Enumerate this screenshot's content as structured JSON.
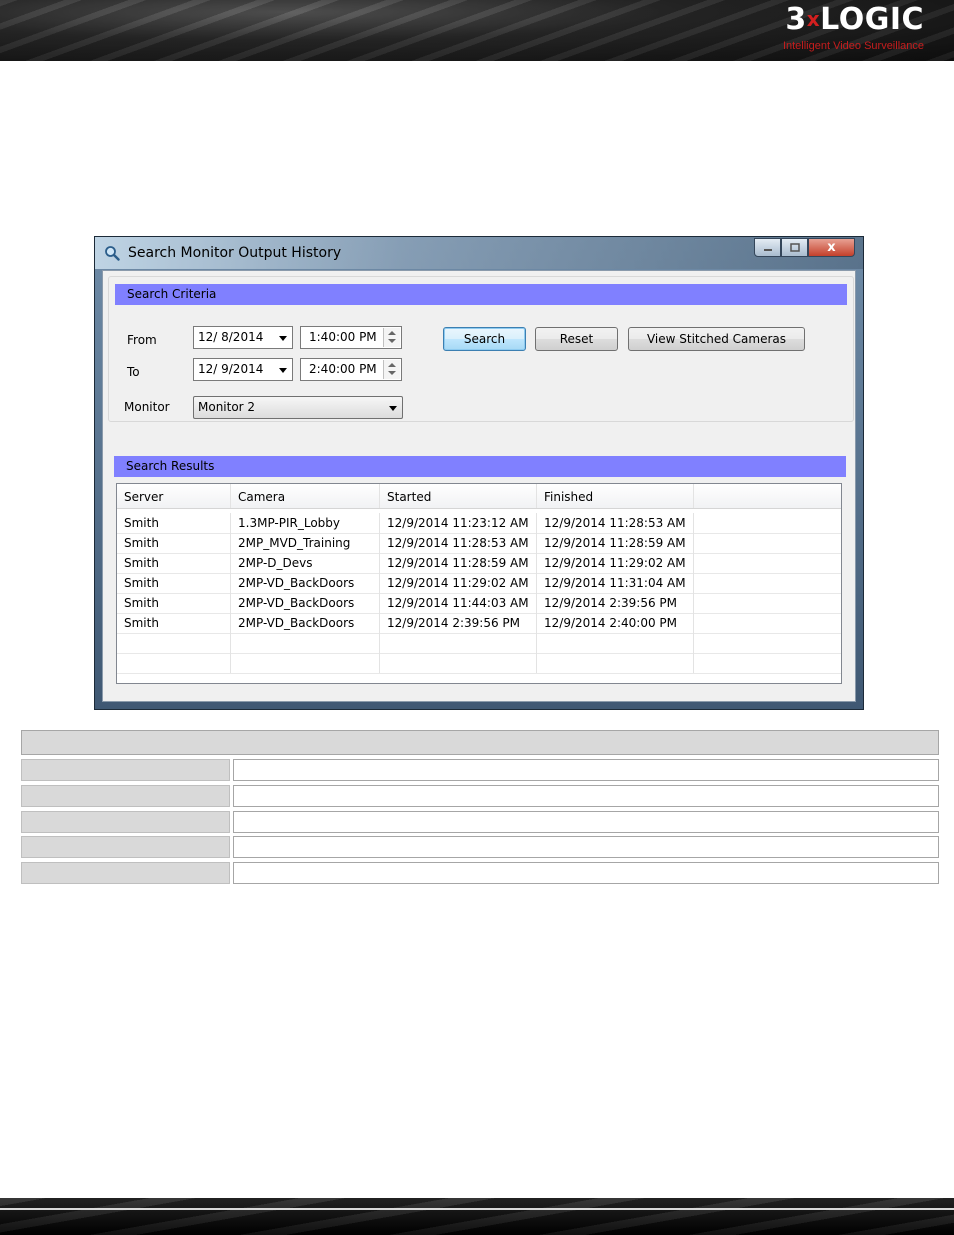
{
  "brand": {
    "logo_main": "3",
    "logo_x": "x",
    "logo_rest": "LOGIC",
    "tagline": "Intelligent Video Surveillance"
  },
  "window": {
    "title": "Search Monitor Output History",
    "title_icon": "magnifier-icon",
    "close_glyph": "x"
  },
  "criteria": {
    "header": "Search Criteria",
    "from_label": "From",
    "to_label": "To",
    "monitor_label": "Monitor",
    "from_date": "12/ 8/2014",
    "from_time": "1:40:00 PM",
    "to_date": "12/ 9/2014",
    "to_time": "2:40:00 PM",
    "monitor_value": "Monitor 2",
    "search_button": "Search",
    "reset_button": "Reset",
    "stitched_button": "View Stitched Cameras"
  },
  "results": {
    "header": "Search Results",
    "columns": [
      "Server",
      "Camera",
      "Started",
      "Finished",
      ""
    ],
    "rows": [
      [
        "Smith",
        "1.3MP-PIR_Lobby",
        "12/9/2014 11:23:12 AM",
        "12/9/2014 11:28:53 AM",
        ""
      ],
      [
        "Smith",
        "2MP_MVD_Training",
        "12/9/2014 11:28:53 AM",
        "12/9/2014 11:28:59 AM",
        ""
      ],
      [
        "Smith",
        "2MP-D_Devs",
        "12/9/2014 11:28:59 AM",
        "12/9/2014 11:29:02 AM",
        ""
      ],
      [
        "Smith",
        "2MP-VD_BackDoors",
        "12/9/2014 11:29:02 AM",
        "12/9/2014 11:31:04 AM",
        ""
      ],
      [
        "Smith",
        "2MP-VD_BackDoors",
        "12/9/2014 11:44:03 AM",
        "12/9/2014 2:39:56 PM",
        ""
      ],
      [
        "Smith",
        "2MP-VD_BackDoors",
        "12/9/2014 2:39:56 PM",
        "12/9/2014 2:40:00 PM",
        ""
      ],
      [
        "",
        "",
        "",
        "",
        ""
      ],
      [
        "",
        "",
        "",
        "",
        ""
      ]
    ]
  }
}
